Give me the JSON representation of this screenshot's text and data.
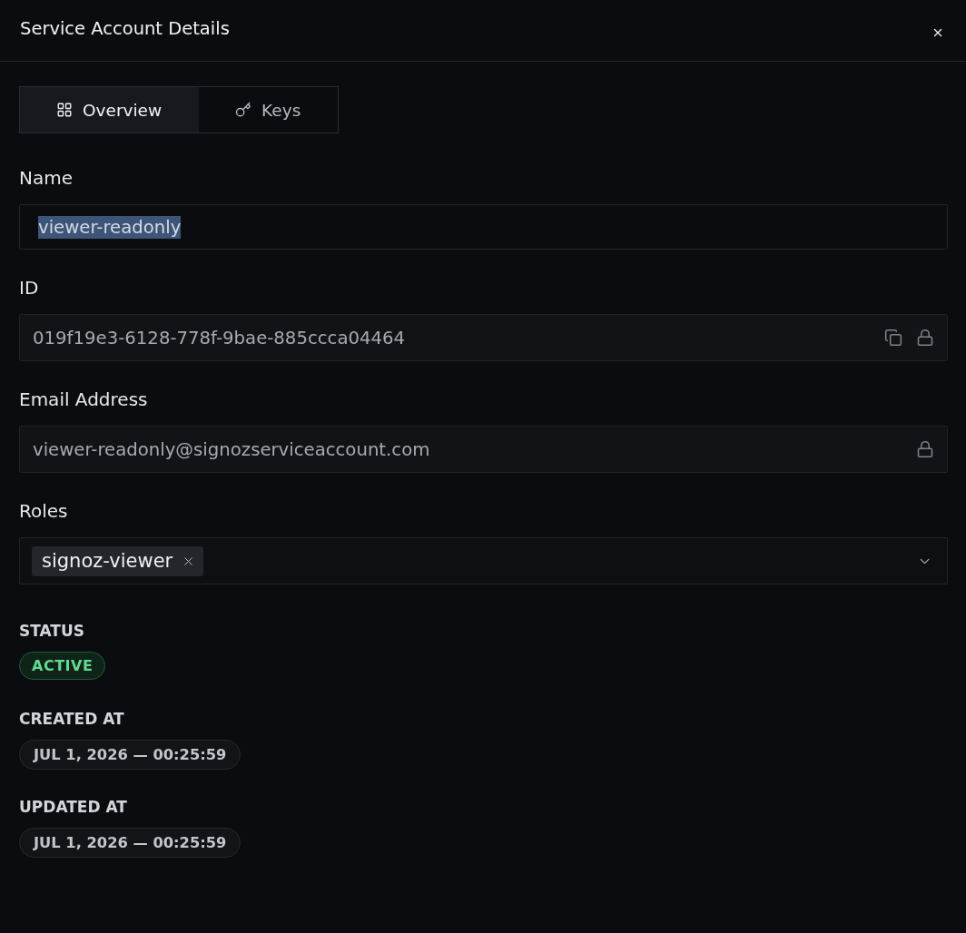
{
  "dialog": {
    "title": "Service Account Details"
  },
  "tabs": [
    {
      "label": "Overview",
      "kind": "overview",
      "selected": true
    },
    {
      "label": "Keys",
      "kind": "keys",
      "selected": false
    }
  ],
  "fields": [
    {
      "label": "Name",
      "value": "viewer-readonly",
      "disabled": false,
      "text_selected": true,
      "copyable": false,
      "locked": false
    },
    {
      "label": "ID",
      "value": "019f19e3-6128-778f-9bae-885ccca04464",
      "disabled": true,
      "text_selected": false,
      "copyable": true,
      "locked": true
    },
    {
      "label": "Email Address",
      "value": "viewer-readonly@signozserviceaccount.com",
      "disabled": true,
      "text_selected": false,
      "copyable": false,
      "locked": true
    }
  ],
  "roles": {
    "label": "Roles",
    "tags": [
      {
        "label": "signoz-viewer"
      }
    ]
  },
  "status": {
    "label": "STATUS",
    "badge": {
      "label": "ACTIVE",
      "kind": "active"
    }
  },
  "timestamps": [
    {
      "label": "CREATED AT",
      "value": "JUL 1, 2026 — 00:25:59"
    },
    {
      "label": "UPDATED AT",
      "value": "JUL 1, 2026 — 00:25:59"
    }
  ]
}
